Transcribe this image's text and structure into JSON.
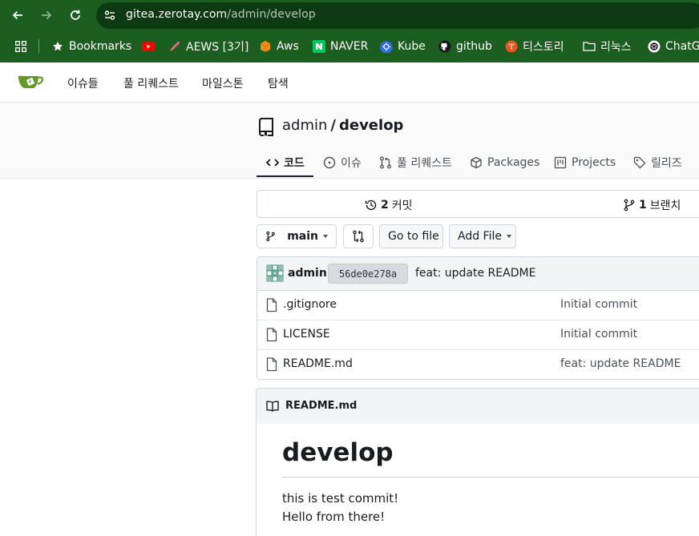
{
  "browser": {
    "url_host": "gitea.zerotay.com",
    "url_path": "/admin/develop",
    "bookmarks": [
      {
        "label": "Bookmarks",
        "icon": "star-icon"
      },
      {
        "label": "",
        "icon": "youtube-icon"
      },
      {
        "label": "AEWS [3기]",
        "icon": "rocket-icon"
      },
      {
        "label": "Aws",
        "icon": "aws-cube-icon"
      },
      {
        "label": "NAVER",
        "icon": "naver-icon"
      },
      {
        "label": "Kube",
        "icon": "kubernetes-icon"
      },
      {
        "label": "github",
        "icon": "github-icon"
      },
      {
        "label": "티스토리",
        "icon": "tistory-icon"
      },
      {
        "label": "리눅스",
        "icon": "folder-icon"
      },
      {
        "label": "ChatG",
        "icon": "chatgpt-icon"
      }
    ]
  },
  "topnav": {
    "items": [
      "이슈들",
      "풀 리퀘스트",
      "마일스톤",
      "탐색"
    ]
  },
  "repo": {
    "owner": "admin",
    "slash": "/",
    "name": "develop",
    "tabs": [
      "코드",
      "이슈",
      "풀 리퀘스트",
      "Packages",
      "Projects",
      "릴리즈"
    ]
  },
  "stats": {
    "commits_count": "2",
    "commits_label": "커밋",
    "branches_count": "1",
    "branches_label": "브랜치"
  },
  "toolbar": {
    "branch": "main",
    "go_to_file": "Go to file",
    "add_file": "Add File"
  },
  "latest_commit": {
    "author": "admin",
    "sha": "56de0e278a",
    "message": "feat: update README"
  },
  "files": [
    {
      "name": ".gitignore",
      "message": "Initial commit"
    },
    {
      "name": "LICENSE",
      "message": "Initial commit"
    },
    {
      "name": "README.md",
      "message": "feat: update README"
    }
  ],
  "readme": {
    "filename": "README.md",
    "heading": "develop",
    "lines": [
      "this is test commit!",
      "Hello from there!"
    ]
  },
  "colors": {
    "chrome_bg": "#1b5e20",
    "gitea_green": "#609926"
  }
}
